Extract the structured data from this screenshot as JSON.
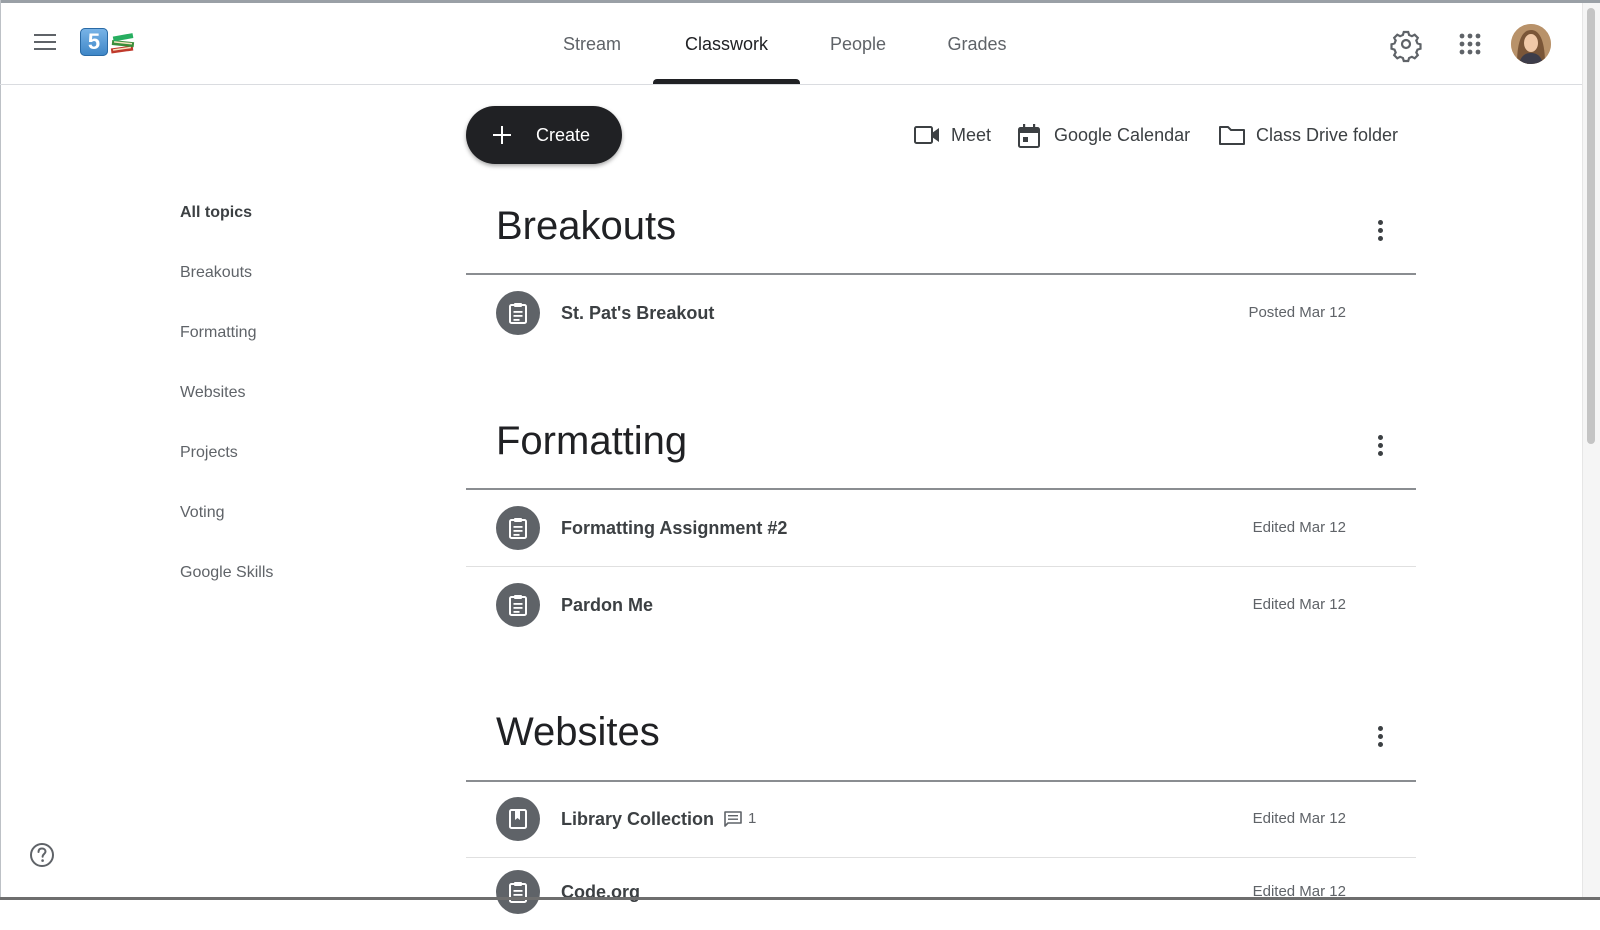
{
  "header": {
    "logo_number": "5",
    "tabs": [
      {
        "label": "Stream",
        "active": false
      },
      {
        "label": "Classwork",
        "active": true
      },
      {
        "label": "People",
        "active": false
      },
      {
        "label": "Grades",
        "active": false
      }
    ],
    "icons": {
      "menu": "hamburger-menu-icon",
      "settings": "gear-icon",
      "apps": "apps-grid-icon",
      "avatar": "user-avatar"
    }
  },
  "toolbar": {
    "create_label": "Create",
    "meet_label": "Meet",
    "calendar_label": "Google Calendar",
    "drive_label": "Class Drive folder"
  },
  "sidebar": {
    "topics": [
      "All topics",
      "Breakouts",
      "Formatting",
      "Websites",
      "Projects",
      "Voting",
      "Google Skills"
    ]
  },
  "sections": [
    {
      "title": "Breakouts",
      "items": [
        {
          "title": "St. Pat's Breakout",
          "date": "Posted Mar 12",
          "type": "assignment"
        }
      ]
    },
    {
      "title": "Formatting",
      "items": [
        {
          "title": "Formatting Assignment #2",
          "date": "Edited Mar 12",
          "type": "assignment"
        },
        {
          "title": "Pardon Me",
          "date": "Edited Mar 12",
          "type": "assignment"
        }
      ]
    },
    {
      "title": "Websites",
      "items": [
        {
          "title": "Library Collection",
          "date": "Edited Mar 12",
          "type": "material",
          "comments": "1"
        },
        {
          "title": "Code.org",
          "date": "Edited Mar 12",
          "type": "assignment"
        }
      ]
    }
  ],
  "colors": {
    "accent": "#202124",
    "icon_bg": "#5f6368",
    "muted_text": "#5f6368"
  }
}
